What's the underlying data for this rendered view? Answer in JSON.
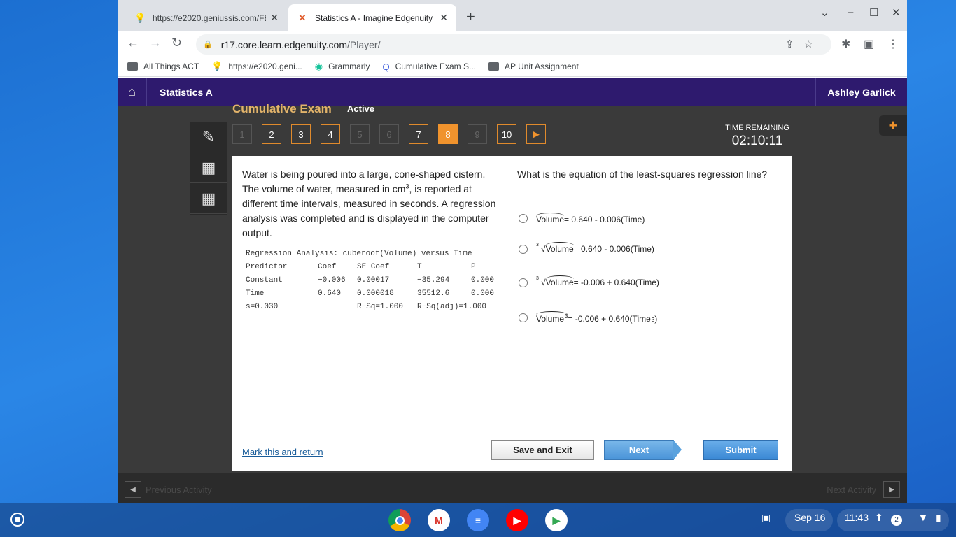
{
  "browser": {
    "tabs": [
      {
        "title": "https://e2020.geniussis.com/FE",
        "icon": "lightbulb-icon"
      },
      {
        "title": "Statistics A - Imagine Edgenuity",
        "icon": "edgenuity-icon"
      }
    ],
    "url_domain": "r17.core.learn.edgenuity.com",
    "url_path": "/Player/",
    "bookmarks": [
      {
        "label": "All Things ACT",
        "icon": "folder-icon"
      },
      {
        "label": "https://e2020.geni...",
        "icon": "lightbulb-icon"
      },
      {
        "label": "Grammarly",
        "icon": "grammarly-icon"
      },
      {
        "label": "Cumulative Exam S...",
        "icon": "q-icon"
      },
      {
        "label": "AP Unit Assignment",
        "icon": "folder-icon"
      }
    ]
  },
  "header": {
    "course": "Statistics A",
    "user": "Ashley Garlick"
  },
  "exam": {
    "title": "Cumulative Exam",
    "status": "Active",
    "questions": [
      {
        "n": "1",
        "state": "disabled"
      },
      {
        "n": "2",
        "state": "answered"
      },
      {
        "n": "3",
        "state": "answered"
      },
      {
        "n": "4",
        "state": "answered"
      },
      {
        "n": "5",
        "state": "disabled"
      },
      {
        "n": "6",
        "state": "disabled"
      },
      {
        "n": "7",
        "state": "answered"
      },
      {
        "n": "8",
        "state": "current"
      },
      {
        "n": "9",
        "state": "disabled"
      },
      {
        "n": "10",
        "state": "answered"
      }
    ],
    "timer_label": "TIME REMAINING",
    "timer_value": "02:10:11"
  },
  "question": {
    "stem_before": "Water is being poured into a large, cone-shaped cistern. The volume of water, measured in cm",
    "stem_sup": "3",
    "stem_after": ", is reported at different time intervals, measured in seconds. A regression analysis was completed and is displayed in the computer output.",
    "output_title": "Regression Analysis: cuberoot(Volume) versus Time",
    "output_header": [
      "Predictor",
      "Coef",
      "SE Coef",
      "T",
      "P"
    ],
    "output_rows": [
      [
        "Constant",
        "−0.006",
        "0.00017",
        "−35.294",
        "0.000"
      ],
      [
        "Time",
        "0.640",
        "0.000018",
        "35512.6",
        "0.000"
      ]
    ],
    "output_stats": [
      "s=0.030",
      "R−Sq=1.000",
      "R−Sq(adj)=1.000"
    ],
    "prompt": "What is the equation of the least-squares regression line?",
    "options": [
      {
        "lhs": "Volume",
        "rhs": " = 0.640 - 0.006(Time)"
      },
      {
        "lhs": "Volume",
        "rhs": " = 0.640 - 0.006(Time)",
        "index": "3"
      },
      {
        "lhs": "Volume",
        "rhs": " = -0.006 + 0.640(Time)",
        "index": "3"
      },
      {
        "lhs": "Volume",
        "exp": "3",
        "rhs": " = -0.006 + 0.640(Time",
        "rhs_exp": "3",
        "rhs_end": ")"
      }
    ]
  },
  "footer": {
    "mark": "Mark this and return",
    "save": "Save and Exit",
    "next": "Next",
    "submit": "Submit"
  },
  "activity": {
    "prev": "Previous Activity",
    "next": "Next Activity"
  },
  "shelf": {
    "date": "Sep 16",
    "time": "11:43",
    "notifications": "2"
  }
}
